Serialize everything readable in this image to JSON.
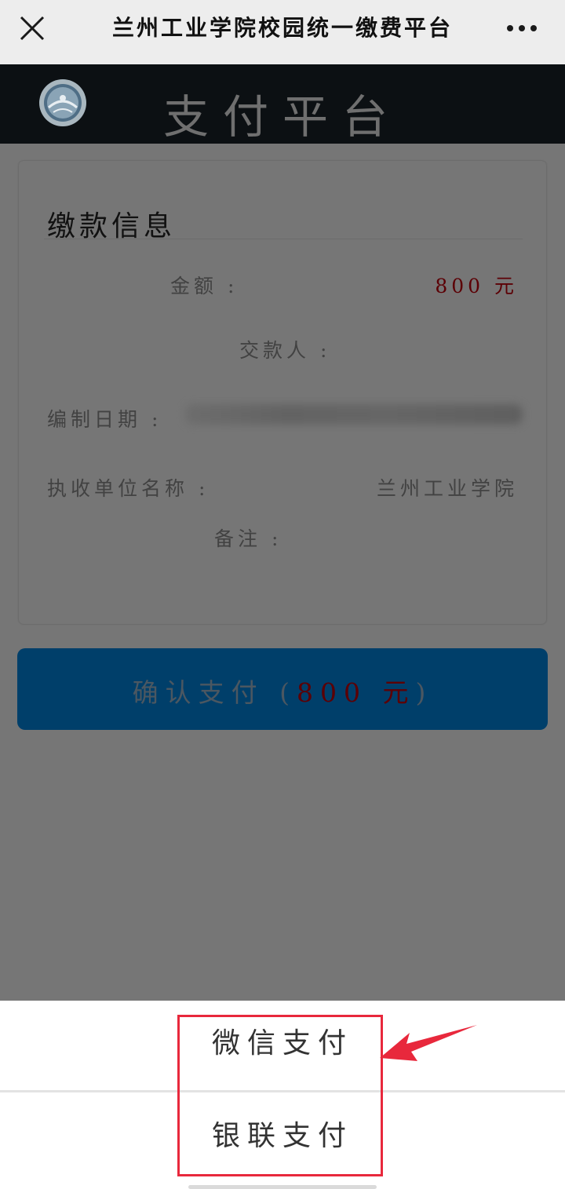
{
  "topbar": {
    "title": "兰州工业学院校园统一缴费平台",
    "close_icon": "close-icon",
    "more_icon": "more-icon"
  },
  "header": {
    "logo_icon": "school-logo",
    "title": "支付平台"
  },
  "card": {
    "title": "缴款信息",
    "fields": {
      "amount_label": "金额 :",
      "amount_value": "800 元",
      "payer_label": "交款人 :",
      "date_label": "编制日期 :",
      "unit_label": "执收单位名称 :",
      "unit_value": "兰州工业学院",
      "remark_label": "备注 :"
    }
  },
  "confirm_button": {
    "prefix": "确认支付 (",
    "amount": "800 元",
    "suffix": ")"
  },
  "payment_sheet": {
    "options": [
      "微信支付",
      "银联支付"
    ]
  },
  "colors": {
    "header_bg": "#0c1013",
    "button_bg": "#003f6a",
    "amount_red": "#5c0005",
    "annotation_red": "#e8283c"
  }
}
